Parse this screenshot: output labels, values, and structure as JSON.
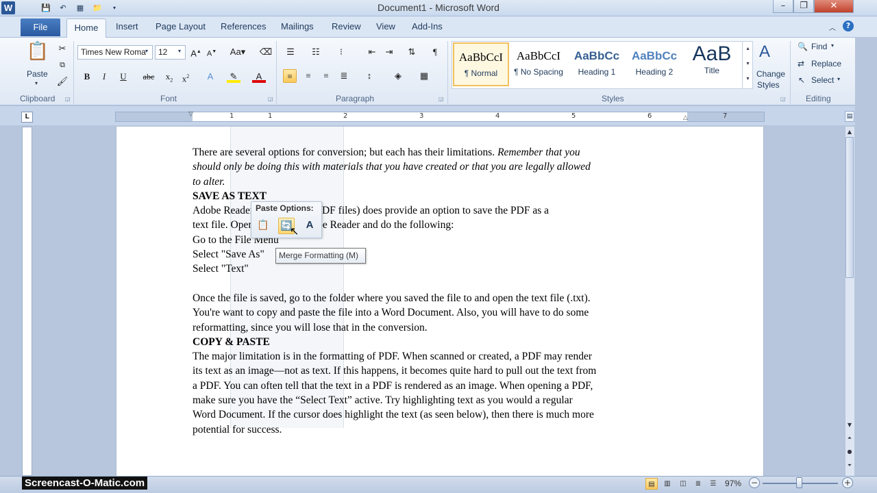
{
  "window": {
    "title": "Document1  -  Microsoft Word",
    "logo_letter": "W"
  },
  "tabs": {
    "file": "File",
    "home": "Home",
    "items": [
      "Insert",
      "Page Layout",
      "References",
      "Mailings",
      "Review",
      "View",
      "Add-Ins"
    ]
  },
  "ribbon": {
    "clipboard": {
      "paste": "Paste",
      "label": "Clipboard"
    },
    "font": {
      "name": "Times New Roma",
      "size": "12",
      "label": "Font"
    },
    "paragraph": {
      "label": "Paragraph"
    },
    "styles": {
      "label": "Styles",
      "items": [
        {
          "preview": "AaBbCcI",
          "name": "¶ Normal"
        },
        {
          "preview": "AaBbCcI",
          "name": "¶ No Spacing"
        },
        {
          "preview": "AaBbCc",
          "name": "Heading 1"
        },
        {
          "preview": "AaBbCc",
          "name": "Heading 2"
        },
        {
          "preview": "AaB",
          "name": "Title"
        }
      ],
      "change_line1": "Change",
      "change_line2": "Styles"
    },
    "editing": {
      "find": "Find",
      "replace": "Replace",
      "select": "Select",
      "label": "Editing"
    }
  },
  "ruler": {
    "numbers": [
      "1",
      "1",
      "2",
      "3",
      "4",
      "5",
      "6",
      "7"
    ],
    "tab_selector": "L"
  },
  "document": {
    "lines": [
      {
        "text": "There are several options for conversion; but each has their limitations.",
        "ital": " Remember that you"
      },
      {
        "text": "",
        "ital": "should only be doing this with materials that you have created or that you are legally allowed"
      },
      {
        "text": "",
        "ital": "to alter."
      },
      {
        "head": "SAVE AS TEXT"
      },
      {
        "text": "Adobe Reader (used to open PDF files) does provide an option to save the PDF as a"
      },
      {
        "text": "text file.  Open the file in Adobe Reader and do the following:"
      },
      {
        "text": " Go to the File Menu"
      },
      {
        "text": " Select \"Save As\""
      },
      {
        "text": " Select \"Text\""
      },
      {
        "blank": true
      },
      {
        "text": "Once the file is saved, go to the folder where you saved the file to and open the text file (.txt)."
      },
      {
        "text": "You're want to copy and paste the file into a Word Document. Also, you will have to do some"
      },
      {
        "text": "reformatting, since you will lose that in the conversion."
      },
      {
        "head": "COPY & PASTE"
      },
      {
        "text": "The major limitation is in the formatting of PDF. When scanned or created, a PDF may render"
      },
      {
        "text": "its text as an image—not as text. If this happens, it becomes quite hard to pull out the text from"
      },
      {
        "text": "a PDF.  You can often tell that the text in a PDF is rendered as an image.  When opening a PDF,"
      },
      {
        "text": "make sure you have the “Select  Text” active. Try highlighting  text as you would a regular"
      },
      {
        "text": "Word Document. If the cursor does highlight the text (as seen below), then there is much more"
      },
      {
        "text": "potential for success."
      }
    ]
  },
  "paste_options": {
    "title": "Paste Options:",
    "tooltip": "Merge Formatting (M)"
  },
  "status": {
    "watermark": "Screencast-O-Matic.com",
    "zoom": "97%"
  }
}
